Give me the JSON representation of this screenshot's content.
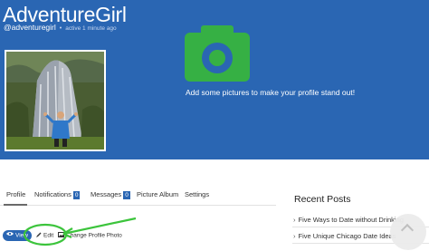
{
  "profile": {
    "display_name": "AdventureGirl",
    "handle": "@adventuregirl",
    "separator": "•",
    "activity": "active 1 minute ago",
    "photo_prompt": "Add some pictures to make your profile stand out!"
  },
  "tabs": [
    {
      "label": "Profile"
    },
    {
      "label": "Notifications",
      "count": "0"
    },
    {
      "label": "Messages",
      "count": "0"
    },
    {
      "label": "Picture Album"
    },
    {
      "label": "Settings"
    }
  ],
  "actions": {
    "view": "View",
    "edit": "Edit",
    "change_photo": "Change Profile Photo"
  },
  "sidebar": {
    "title": "Recent Posts",
    "posts": [
      "Five Ways to Date without Drinking",
      "Five Unique Chicago Date Ideas"
    ]
  },
  "colors": {
    "hero_blue": "#2a66b3",
    "camera_green": "#36b044",
    "annotation_green": "#3cc43c"
  }
}
